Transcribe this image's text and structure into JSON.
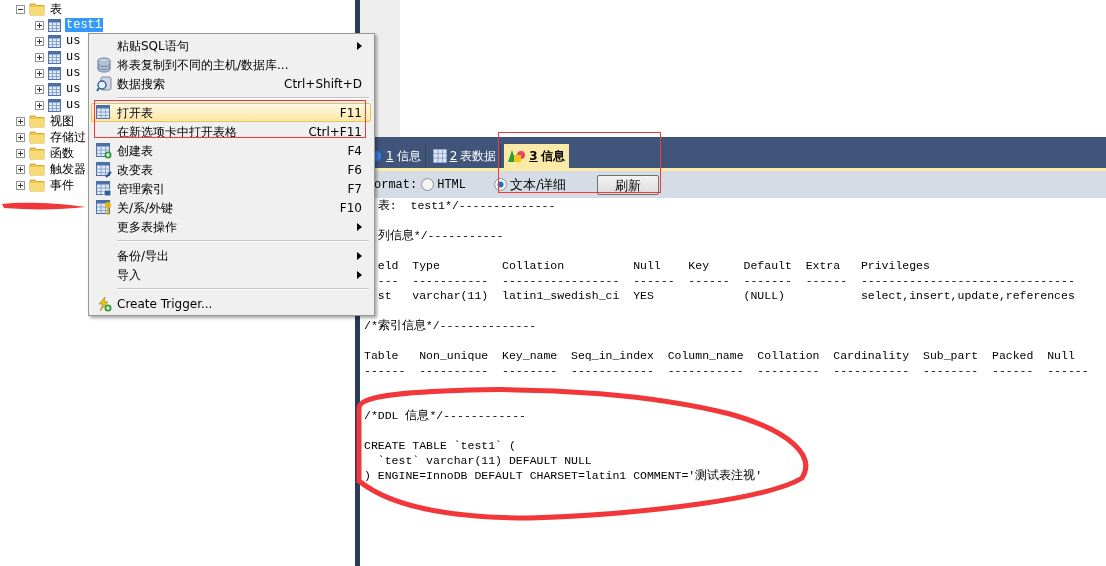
{
  "tree": [
    {
      "kind": "folder",
      "label": "表",
      "expanded": true,
      "selected": false,
      "children": [
        {
          "kind": "table",
          "label": "test1",
          "expanded": false,
          "selected": true
        },
        {
          "kind": "table",
          "label": "us",
          "expanded": false,
          "selected": false
        },
        {
          "kind": "table",
          "label": "us",
          "expanded": false,
          "selected": false
        },
        {
          "kind": "table",
          "label": "us",
          "expanded": false,
          "selected": false
        },
        {
          "kind": "table",
          "label": "us",
          "expanded": false,
          "selected": false
        },
        {
          "kind": "table",
          "label": "us",
          "expanded": false,
          "selected": false
        }
      ]
    },
    {
      "kind": "folder",
      "label": "视图",
      "expanded": false,
      "selected": false
    },
    {
      "kind": "folder",
      "label": "存储过",
      "expanded": false,
      "selected": false
    },
    {
      "kind": "folder",
      "label": "函数",
      "expanded": false,
      "selected": false
    },
    {
      "kind": "folder",
      "label": "触发器",
      "expanded": false,
      "selected": false
    },
    {
      "kind": "folder",
      "label": "事件",
      "expanded": false,
      "selected": false
    }
  ],
  "context_menu": {
    "groups": [
      [
        {
          "label": "粘贴SQL语句",
          "submenu": true,
          "selected": false
        },
        {
          "label": "将表复制到不同的主机/数据库...",
          "submenu": false,
          "selected": false
        },
        {
          "label": "数据搜索",
          "shortcut": "Ctrl+Shift+D",
          "submenu": false,
          "selected": false
        }
      ],
      [
        {
          "label": "打开表",
          "shortcut": "F11",
          "submenu": false,
          "selected": true
        },
        {
          "label": "在新选项卡中打开表格",
          "shortcut": "Ctrl+F11",
          "submenu": false,
          "selected": false
        },
        {
          "label": "创建表",
          "shortcut": "F4",
          "submenu": false,
          "selected": false
        },
        {
          "label": "改变表",
          "shortcut": "F6",
          "submenu": false,
          "selected": false
        },
        {
          "label": "管理索引",
          "shortcut": "F7",
          "submenu": false,
          "selected": false
        },
        {
          "label": "关/系/外键",
          "shortcut": "F10",
          "submenu": false,
          "selected": false
        },
        {
          "label": "更多表操作",
          "submenu": true,
          "selected": false
        }
      ],
      [
        {
          "label": "备份/导出",
          "submenu": true,
          "selected": false
        },
        {
          "label": "导入",
          "submenu": true,
          "selected": false
        }
      ],
      [
        {
          "label": "Create Trigger...",
          "submenu": false,
          "selected": false
        }
      ]
    ]
  },
  "tabs": [
    {
      "key": "1",
      "label": "信息",
      "selected": false
    },
    {
      "key": "2",
      "label": "表数据",
      "selected": false
    },
    {
      "key": "3",
      "label": "信息",
      "selected": true
    }
  ],
  "toolbar": {
    "format_label": "ormat:",
    "options": [
      {
        "label": "HTML",
        "selected": false
      },
      {
        "label": "文本/详细",
        "selected": true
      }
    ],
    "refresh_button": "刷新"
  },
  "output_lines": [
    {
      "kind": "partial",
      "text": "表:  test1*/--------------"
    },
    {
      "kind": "blank"
    },
    {
      "kind": "partial",
      "text": "列信息*/-----------"
    },
    {
      "kind": "blank"
    },
    {
      "kind": "partial",
      "text": "eld  Type         Collation          Null    Key     Default  Extra   Privileges"
    },
    {
      "kind": "partial",
      "text": "---  -----------  -----------------  ------  ------  -------  ------  -------------------------------"
    },
    {
      "kind": "partial",
      "text": "st   varchar(11)  latin1_swedish_ci  YES             (NULL)           select,insert,update,references"
    },
    {
      "kind": "blank"
    },
    {
      "kind": "full",
      "text": "/*索引信息*/--------------"
    },
    {
      "kind": "blank"
    },
    {
      "kind": "full",
      "text": "Table   Non_unique  Key_name  Seq_in_index  Column_name  Collation  Cardinality  Sub_part  Packed  Null"
    },
    {
      "kind": "full",
      "text": "------  ----------  --------  ------------  -----------  ---------  -----------  --------  ------  ------"
    },
    {
      "kind": "blank"
    },
    {
      "kind": "blank"
    },
    {
      "kind": "full",
      "text": "/*DDL 信息*/------------"
    },
    {
      "kind": "blank"
    },
    {
      "kind": "full",
      "text": "CREATE TABLE `test1` ("
    },
    {
      "kind": "full",
      "text": "  `test` varchar(11) DEFAULT NULL"
    },
    {
      "kind": "full",
      "text": ") ENGINE=InnoDB DEFAULT CHARSET=latin1 COMMENT='测试表注视'"
    }
  ]
}
